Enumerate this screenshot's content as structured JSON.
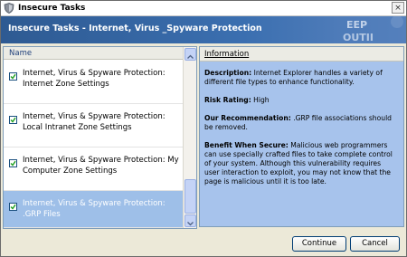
{
  "window": {
    "title": "Insecure Tasks",
    "close_glyph": "×",
    "app_icon": "shield-icon"
  },
  "banner": {
    "heading": "Insecure Tasks - Internet, Virus _Spyware Protection"
  },
  "task_list": {
    "column_header": "Name",
    "items": [
      {
        "label": "Internet, Virus & Spyware Protection: Internet Zone Settings",
        "checked": true,
        "selected": false
      },
      {
        "label": "Internet, Virus & Spyware Protection: Local Intranet Zone Settings",
        "checked": true,
        "selected": false
      },
      {
        "label": "Internet, Virus & Spyware Protection: My Computer Zone Settings",
        "checked": true,
        "selected": false
      },
      {
        "label": "Internet, Virus & Spyware Protection: .GRP Files",
        "checked": true,
        "selected": true
      }
    ]
  },
  "info": {
    "header": "Information",
    "description_label": "Description:",
    "description": "Internet Explorer handles a variety of different file types to enhance functionality.",
    "risk_label": "Risk Rating:",
    "risk": "High",
    "recommendation_label": "Our Recommendation:",
    "recommendation": ".GRP file associations should be removed.",
    "benefit_label": "Benefit When Secure:",
    "benefit": "Malicious web programmers can use specially crafted files to take complete control of your system. Although this vulnerability requires user interaction to exploit, you may not know that the page is malicious until it is too late."
  },
  "buttons": {
    "continue": "Continue",
    "cancel": "Cancel"
  },
  "colors": {
    "banner": "#3b6fb0",
    "info_panel": "#a7c3ec",
    "selection": "#9ebfe8"
  }
}
